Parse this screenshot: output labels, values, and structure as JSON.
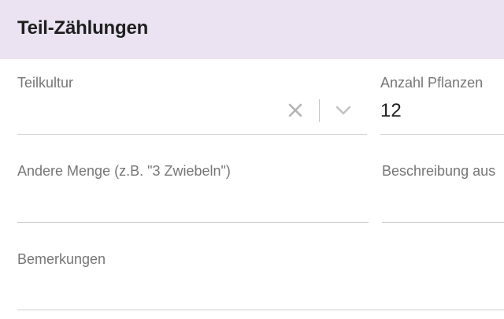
{
  "header": {
    "title": "Teil-Zählungen"
  },
  "form": {
    "teilkultur": {
      "label": "Teilkultur",
      "value": ""
    },
    "anzahl_pflanzen": {
      "label": "Anzahl Pflanzen",
      "value": "12"
    },
    "andere_menge": {
      "label": "Andere Menge (z.B. \"3 Zwiebeln\")",
      "value": ""
    },
    "beschreibung": {
      "label": "Beschreibung aus",
      "value": ""
    },
    "bemerkungen": {
      "label": "Bemerkungen",
      "value": ""
    }
  },
  "icons": {
    "clear": "close-icon",
    "dropdown": "chevron-down-icon"
  },
  "colors": {
    "header_bg": "#ebe3f2",
    "label_text": "#767676",
    "value_text": "#1f1f1f",
    "underline": "#cfcfcf",
    "icon": "#b4b4b4"
  }
}
